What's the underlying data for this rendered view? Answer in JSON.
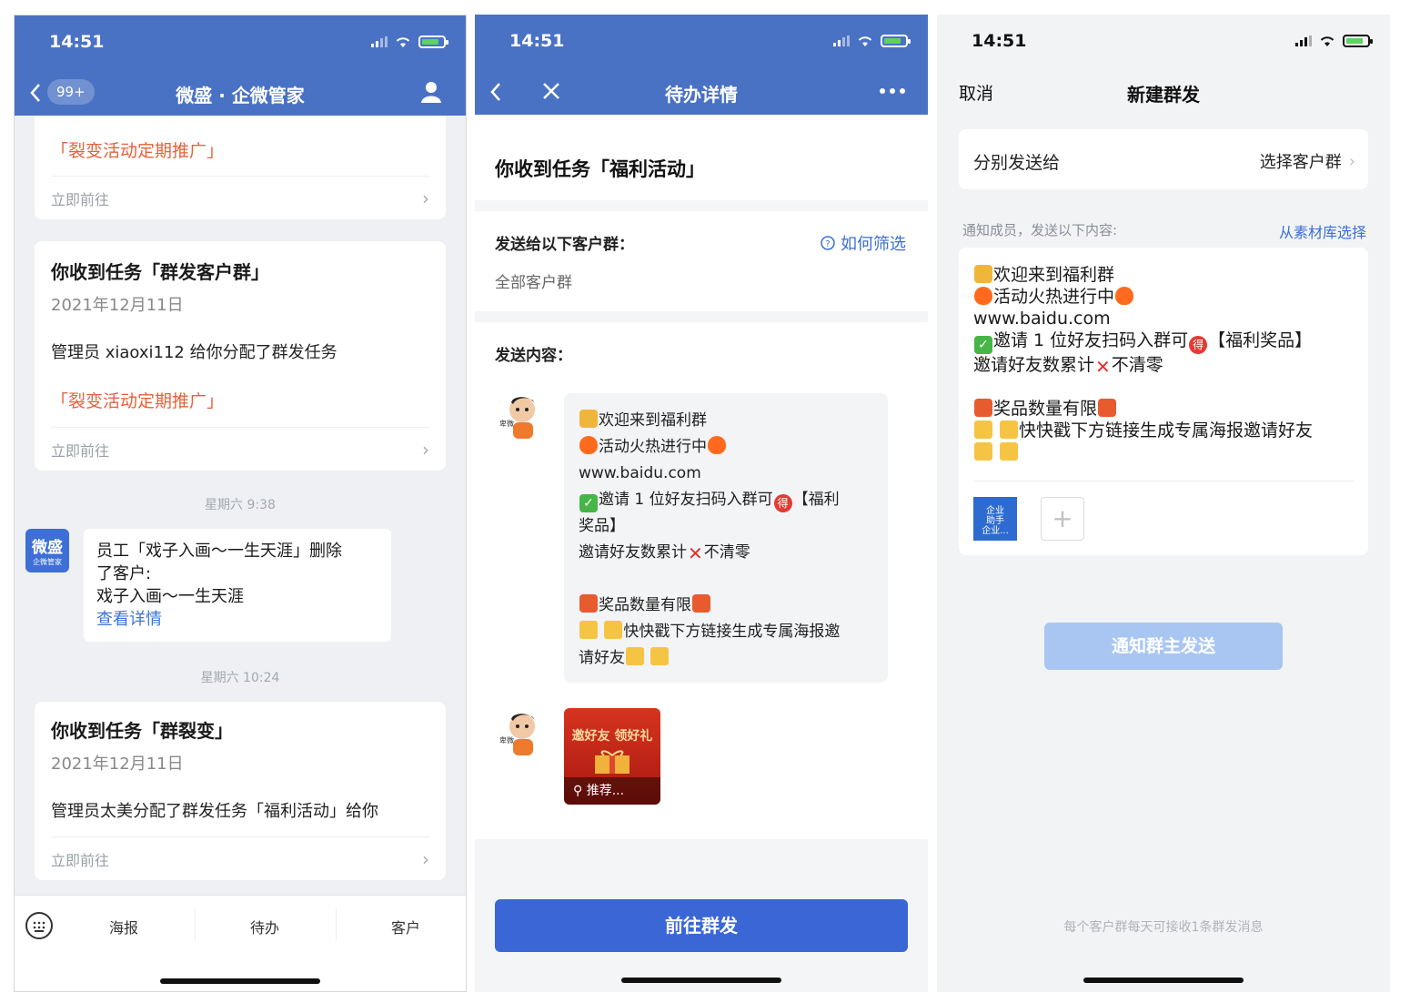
{
  "status": {
    "time": "14:51"
  },
  "p1": {
    "badge": "99+",
    "title": "微盛 · 企微管家",
    "card0": {
      "tag": "「裂变活动定期推广」",
      "go": "立即前往"
    },
    "card1": {
      "title": "你收到任务「群发客户群」",
      "date": "2021年12月11日",
      "body": "管理员 xiaoxi112 给你分配了群发任务",
      "tag": "「裂变活动定期推广」",
      "go": "立即前往"
    },
    "time1": "星期六 9:38",
    "sys": {
      "avatar_line1": "微盛",
      "avatar_line2": "企微管家",
      "l1": "员工「戏子入画～一生天涯」删除",
      "l2": "了客户:",
      "l3": "戏子入画～一生天涯",
      "link": "查看详情"
    },
    "time2": "星期六 10:24",
    "card2": {
      "title": "你收到任务「群裂变」",
      "date": "2021年12月11日",
      "body": "管理员太美分配了群发任务「福利活动」给你",
      "go": "立即前往"
    },
    "tabs": [
      "海报",
      "待办",
      "客户"
    ]
  },
  "p2": {
    "title": "待办详情",
    "task": "你收到任务「福利活动」",
    "send_to_label": "发送给以下客户群：",
    "how": "如何筛选",
    "target": "全部客户群",
    "content_label": "发送内容：",
    "msg": {
      "l1": "欢迎来到福利群",
      "l2": "活动火热进行中",
      "l3": "www.baidu.com",
      "l4a": "邀请 1 位好友扫码入群可",
      "l4b": "【福利",
      "l5": "奖品】",
      "l6a": "邀请好友数累计",
      "l6b": "不清零",
      "l7": "奖品数量有限",
      "l8": "快快戳下方链接生成专属海报邀",
      "l9": "请好友"
    },
    "avatar_text": "卑微",
    "mini": {
      "banner": "邀好友 领好礼",
      "label": "推荐..."
    },
    "button": "前往群发"
  },
  "p3": {
    "cancel": "取消",
    "title": "新建群发",
    "send_each": "分别发送给",
    "choose": "选择客户群",
    "notice": "通知成员，发送以下内容:",
    "library": "从素材库选择",
    "msg": {
      "l1": "欢迎来到福利群",
      "l2": "活动火热进行中",
      "l3": "www.baidu.com",
      "l4a": "邀请 1 位好友扫码入群可",
      "l4b": "【福利奖品】",
      "l5a": "邀请好友数累计",
      "l5b": "不清零",
      "l6": "奖品数量有限",
      "l7": "快快戳下方链接生成专属海报邀请好友"
    },
    "thumb": {
      "l1": "企业",
      "l2": "助手",
      "l3": "企业..."
    },
    "add": "+",
    "button": "通知群主发送",
    "footer": "每个客户群每天可接收1条群发消息"
  }
}
